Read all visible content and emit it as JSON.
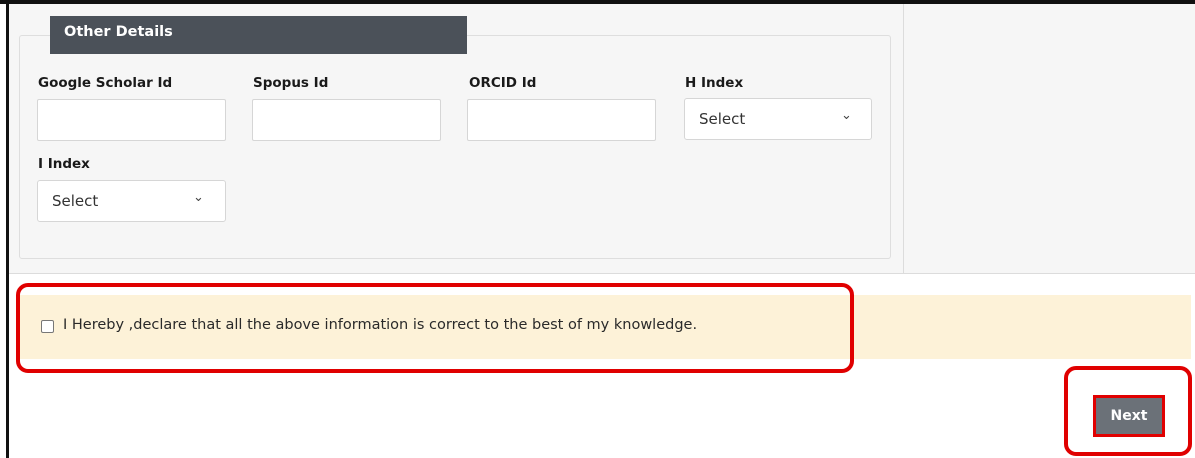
{
  "section": {
    "legend": "Other Details"
  },
  "fields": {
    "google_scholar": {
      "label": "Google Scholar Id",
      "value": ""
    },
    "scopus": {
      "label": "Spopus Id",
      "value": ""
    },
    "orcid": {
      "label": "ORCID Id",
      "value": ""
    },
    "h_index": {
      "label": "H Index",
      "selected": "Select"
    },
    "i_index": {
      "label": "I Index",
      "selected": "Select"
    }
  },
  "declaration": {
    "checked": false,
    "text": "I Hereby ,declare that all the above information is correct to the best of my knowledge."
  },
  "actions": {
    "next_label": "Next"
  },
  "icons": {
    "chevron": "chevron-down-icon"
  },
  "colors": {
    "legend_bg": "#4b5159",
    "declaration_bg": "#fdf2d8",
    "highlight": "#e00000",
    "button_bg": "#6b7178"
  }
}
